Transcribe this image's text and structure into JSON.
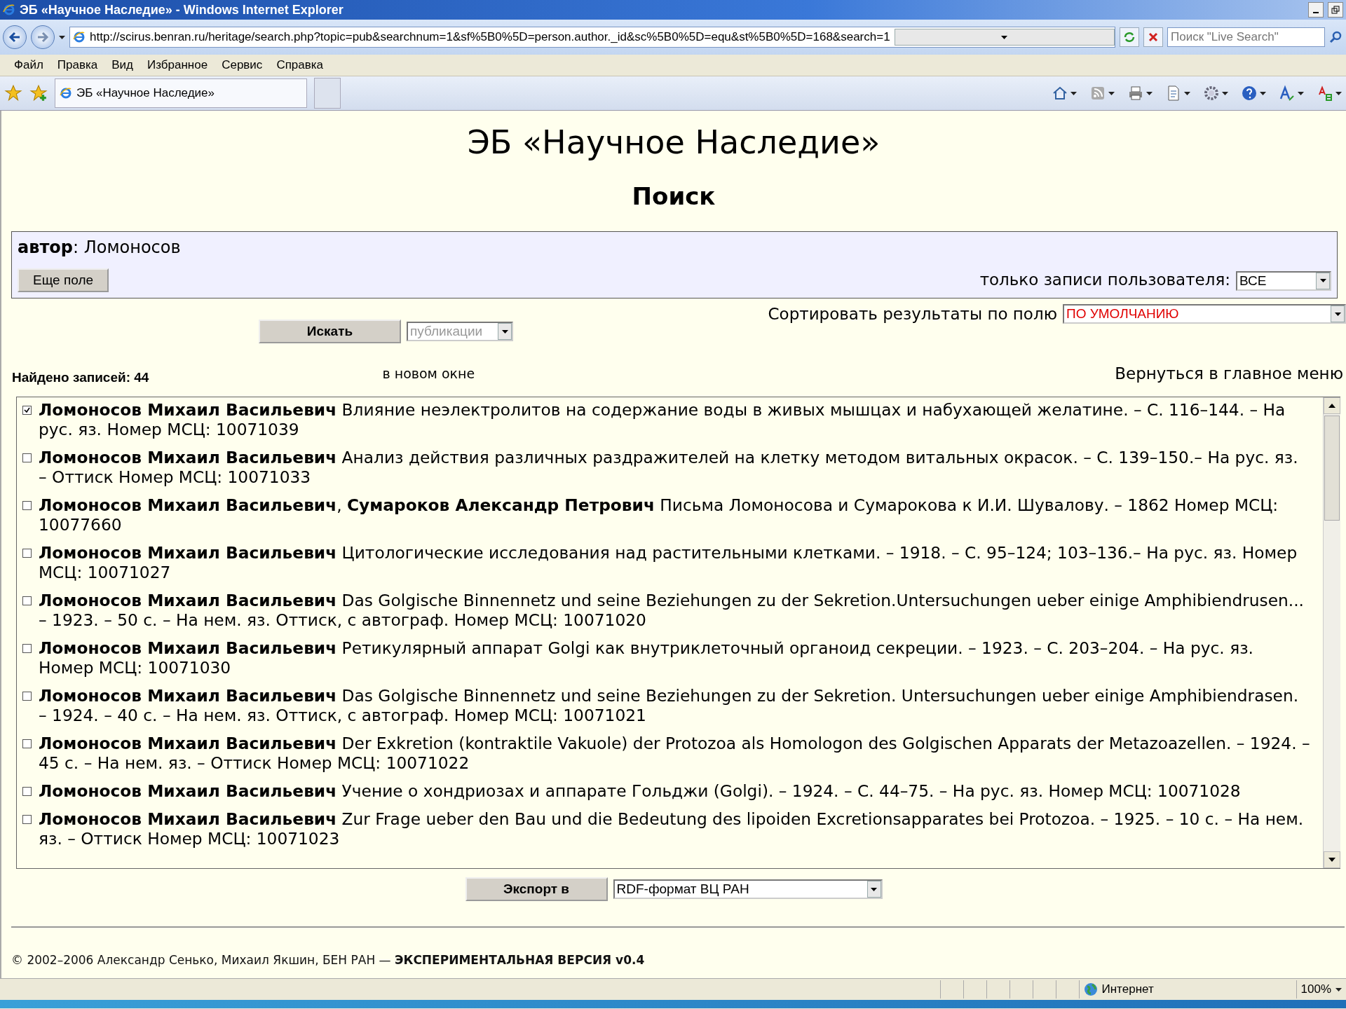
{
  "window": {
    "title": "ЭБ «Научное Наследие» - Windows Internet Explorer"
  },
  "address_bar": {
    "url": "http://scirus.benran.ru/heritage/search.php?topic=pub&searchnum=1&sf%5B0%5D=person.author._id&sc%5B0%5D=equ&st%5B0%5D=168&search=1",
    "search_placeholder": "Поиск \"Live Search\""
  },
  "menu": [
    "Файл",
    "Правка",
    "Вид",
    "Избранное",
    "Сервис",
    "Справка"
  ],
  "tabs": [
    {
      "label": "ЭБ «Научное Наследие»",
      "selected": true
    }
  ],
  "page": {
    "title": "ЭБ «Научное Наследие»",
    "subtitle": "Поиск",
    "criterion": {
      "field": "автор",
      "value": ": Ломоносов"
    },
    "more_field_button": "Еще поле",
    "user_filter": {
      "label": "только записи пользователя:",
      "value": "ВСЕ"
    },
    "sort": {
      "label": "Сортировать результаты по полю",
      "value": "ПО УМОЛЧАНИЮ"
    },
    "search_button": "Искать",
    "search_type": {
      "value": "публикации",
      "disabled": true
    },
    "found": "Найдено записей: 44",
    "new_window": "в новом окне",
    "back_link": "Вернуться в главное меню",
    "results": [
      {
        "checked": true,
        "text": "**Ломоносов Михаил Васильевич** Влияние неэлектролитов на содержание воды в живых мышцах и набухающей желатине. – С. 116–144. – На рус. яз. Номер МСЦ: 10071039"
      },
      {
        "checked": false,
        "text": "**Ломоносов Михаил Васильевич** Анализ действия различных раздражителей на клетку методом витальных окрасок. – С. 139–150.– На рус. яз. – Оттиск Номер МСЦ: 10071033"
      },
      {
        "checked": false,
        "text": "**Ломоносов Михаил Васильевич**, **Сумароков Александр Петрович** Письма Ломоносова и Сумарокова к И.И. Шувалову. – 1862 Номер МСЦ: 10077660"
      },
      {
        "checked": false,
        "text": "**Ломоносов Михаил Васильевич** Цитологические исследования над растительными клетками. – 1918. – С. 95–124; 103–136.– На рус. яз. Номер МСЦ: 10071027"
      },
      {
        "checked": false,
        "text": "**Ломоносов Михаил Васильевич** Das Golgische Binnennetz und seine Beziehungen zu der Sekretion.Untersuchungen ueber einige Amphibiendrusen... – 1923. – 50 с. – На нем. яз. Оттиск, с автограф. Номер МСЦ: 10071020"
      },
      {
        "checked": false,
        "text": "**Ломоносов Михаил Васильевич** Ретикулярный аппарат Golgi как внутриклеточный органоид секреции. – 1923. – С. 203–204. – На рус. яз. Номер МСЦ: 10071030"
      },
      {
        "checked": false,
        "text": "**Ломоносов Михаил Васильевич** Das Golgische Binnennetz und seine Beziehungen zu der Sekretion. Untersuchungen ueber einige Amphibiendrasen. – 1924. – 40 с. – На нем. яз. Оттиск, с автограф. Номер МСЦ: 10071021"
      },
      {
        "checked": false,
        "text": "**Ломоносов Михаил Васильевич** Der Exkretion (kontraktile Vakuole) der Protozoa als Homologon des Golgischen Apparats der Metazoazellen. – 1924. – 45 с. – На нем. яз. – Оттиск Номер МСЦ: 10071022"
      },
      {
        "checked": false,
        "text": "**Ломоносов Михаил Васильевич** Учение о хондриозах и аппарате Гольджи (Golgi). – 1924. – С. 44–75. – На рус. яз. Номер МСЦ: 10071028"
      },
      {
        "checked": false,
        "text": "**Ломоносов Михаил Васильевич** Zur Frage ueber den Bau und die Bedeutung des lipoiden Excretionsapparates bei Protozoa. – 1925. – 10 с. – На нем. яз. – Оттиск Номер МСЦ: 10071023"
      }
    ],
    "export_button": "Экспорт в",
    "export_format": "RDF-формат ВЦ РАН",
    "footer": {
      "text": "© 2002–2006 Александр Сенько, Михаил Якшин, БЕН РАН — ",
      "bold": "ЭКСПЕРИМЕНТАЛЬНАЯ ВЕРСИЯ v0.4"
    }
  },
  "status_bar": {
    "zone": "Интернет",
    "zoom": "100%"
  }
}
